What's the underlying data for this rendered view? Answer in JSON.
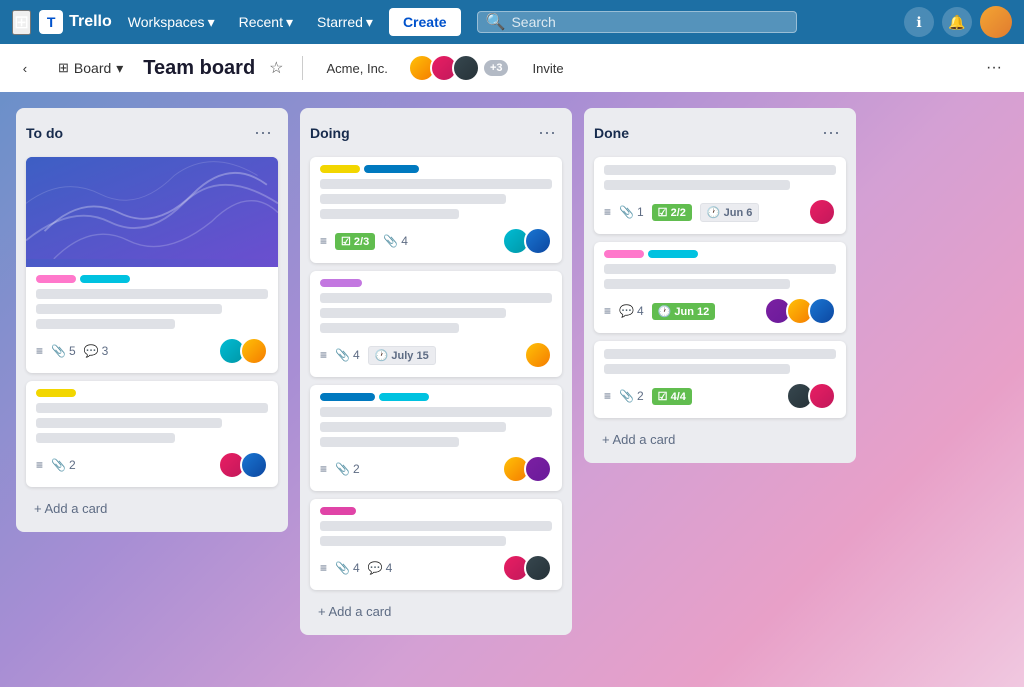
{
  "navbar": {
    "logo": "Trello",
    "workspaces": "Workspaces",
    "recent": "Recent",
    "starred": "Starred",
    "create": "Create",
    "search_placeholder": "Search",
    "info_icon": "ℹ",
    "bell_icon": "🔔"
  },
  "subheader": {
    "board_view": "Board",
    "title": "Team board",
    "workspace": "Acme, Inc.",
    "plus_count": "+3",
    "invite": "Invite",
    "more": "···"
  },
  "columns": [
    {
      "id": "todo",
      "title": "To do",
      "cards": [
        {
          "id": "card-1",
          "has_cover": true,
          "labels": [
            "pink",
            "cyan"
          ],
          "text_lines": [
            "full",
            "medium",
            "short"
          ],
          "meta": {
            "attachments": "5",
            "comments": "3"
          },
          "avatars": [
            "teal",
            "yellow"
          ]
        },
        {
          "id": "card-2",
          "labels": [
            "yellow"
          ],
          "text_lines": [
            "full",
            "medium"
          ],
          "meta": {
            "attachments": "2"
          },
          "avatars": [
            "pink",
            "blue"
          ]
        }
      ],
      "add_label": "+ Add a card"
    },
    {
      "id": "doing",
      "title": "Doing",
      "cards": [
        {
          "id": "card-3",
          "labels": [
            "yellow",
            "blue"
          ],
          "text_lines": [
            "full",
            "medium",
            "short"
          ],
          "meta": {
            "checklist": "2/3",
            "attachments": "4"
          },
          "avatars": [
            "teal",
            "blue"
          ]
        },
        {
          "id": "card-4",
          "labels": [
            "purple"
          ],
          "text_lines": [
            "full",
            "medium",
            "short"
          ],
          "meta": {
            "attachments": "4",
            "date": "July 15"
          },
          "avatars": [
            "yellow"
          ]
        },
        {
          "id": "card-5",
          "labels": [
            "blue",
            "cyan"
          ],
          "text_lines": [
            "full",
            "medium",
            "short"
          ],
          "meta": {
            "attachments": "2"
          },
          "avatars": [
            "yellow",
            "purple"
          ]
        },
        {
          "id": "card-6",
          "labels": [
            "magenta"
          ],
          "text_lines": [
            "full",
            "medium"
          ],
          "meta": {
            "attachments": "4",
            "comments": "4"
          },
          "avatars": [
            "pink",
            "dark"
          ]
        }
      ],
      "add_label": "+ Add a card"
    },
    {
      "id": "done",
      "title": "Done",
      "cards": [
        {
          "id": "card-7",
          "labels": [],
          "text_lines": [
            "full",
            "medium"
          ],
          "meta": {
            "attachments": "1",
            "checklist": "2/2",
            "date": "Jun 6"
          },
          "avatars": [
            "pink"
          ]
        },
        {
          "id": "card-8",
          "labels": [
            "pink",
            "cyan"
          ],
          "text_lines": [
            "full",
            "medium"
          ],
          "meta": {
            "comments": "4",
            "date": "Jun 12"
          },
          "avatars": [
            "purple",
            "yellow",
            "blue"
          ]
        },
        {
          "id": "card-9",
          "labels": [],
          "text_lines": [
            "full",
            "medium"
          ],
          "meta": {
            "attachments": "2",
            "checklist": "4/4"
          },
          "avatars": [
            "dark",
            "pink"
          ]
        }
      ],
      "add_label": "+ Add a card"
    }
  ]
}
